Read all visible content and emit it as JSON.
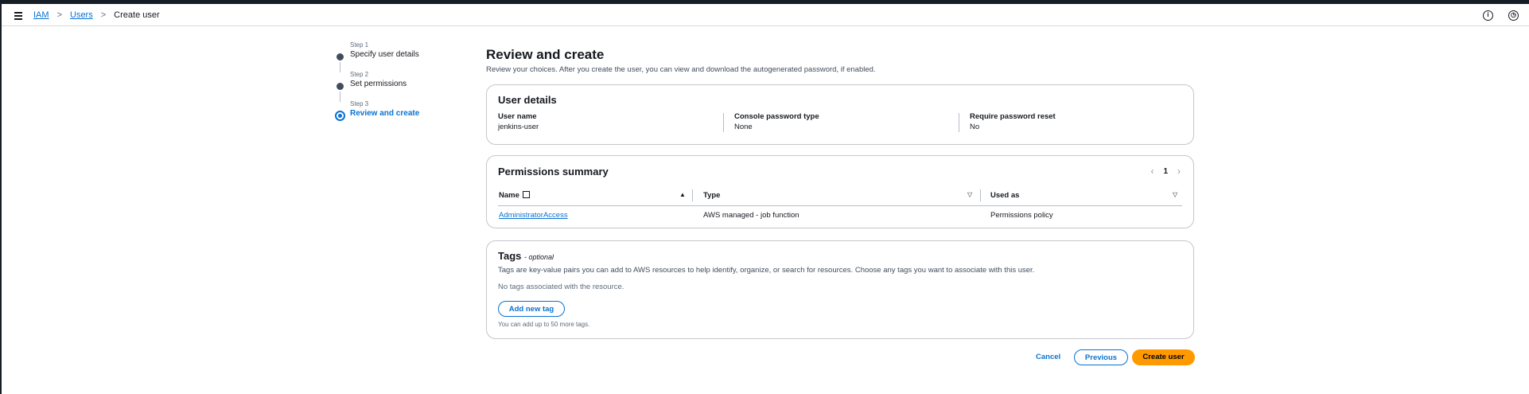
{
  "header": {
    "breadcrumb": [
      "IAM",
      "Users",
      "Create user"
    ],
    "separator": ">"
  },
  "steps": [
    {
      "num": "Step 1",
      "label": "Specify user details"
    },
    {
      "num": "Step 2",
      "label": "Set permissions"
    },
    {
      "num": "Step 3",
      "label": "Review and create"
    }
  ],
  "page": {
    "title": "Review and create",
    "description": "Review your choices. After you create the user, you can view and download the autogenerated password, if enabled."
  },
  "user_details": {
    "title": "User details",
    "fields": [
      {
        "key": "User name",
        "value": "jenkins-user"
      },
      {
        "key": "Console password type",
        "value": "None"
      },
      {
        "key": "Require password reset",
        "value": "No"
      }
    ]
  },
  "permissions": {
    "title": "Permissions summary",
    "page": "1",
    "columns": [
      "Name",
      "Type",
      "Used as"
    ],
    "rows": [
      {
        "name": "AdministratorAccess",
        "type": "AWS managed - job function",
        "used_as": "Permissions policy"
      }
    ]
  },
  "tags": {
    "title": "Tags",
    "optional": "- optional",
    "description": "Tags are key-value pairs you can add to AWS resources to help identify, organize, or search for resources. Choose any tags you want to associate with this user.",
    "empty": "No tags associated with the resource.",
    "add_button": "Add new tag",
    "hint": "You can add up to 50 more tags."
  },
  "actions": {
    "cancel": "Cancel",
    "previous": "Previous",
    "create": "Create user"
  },
  "colors": {
    "accent": "#0972d3",
    "primary_button": "#ff9900"
  }
}
